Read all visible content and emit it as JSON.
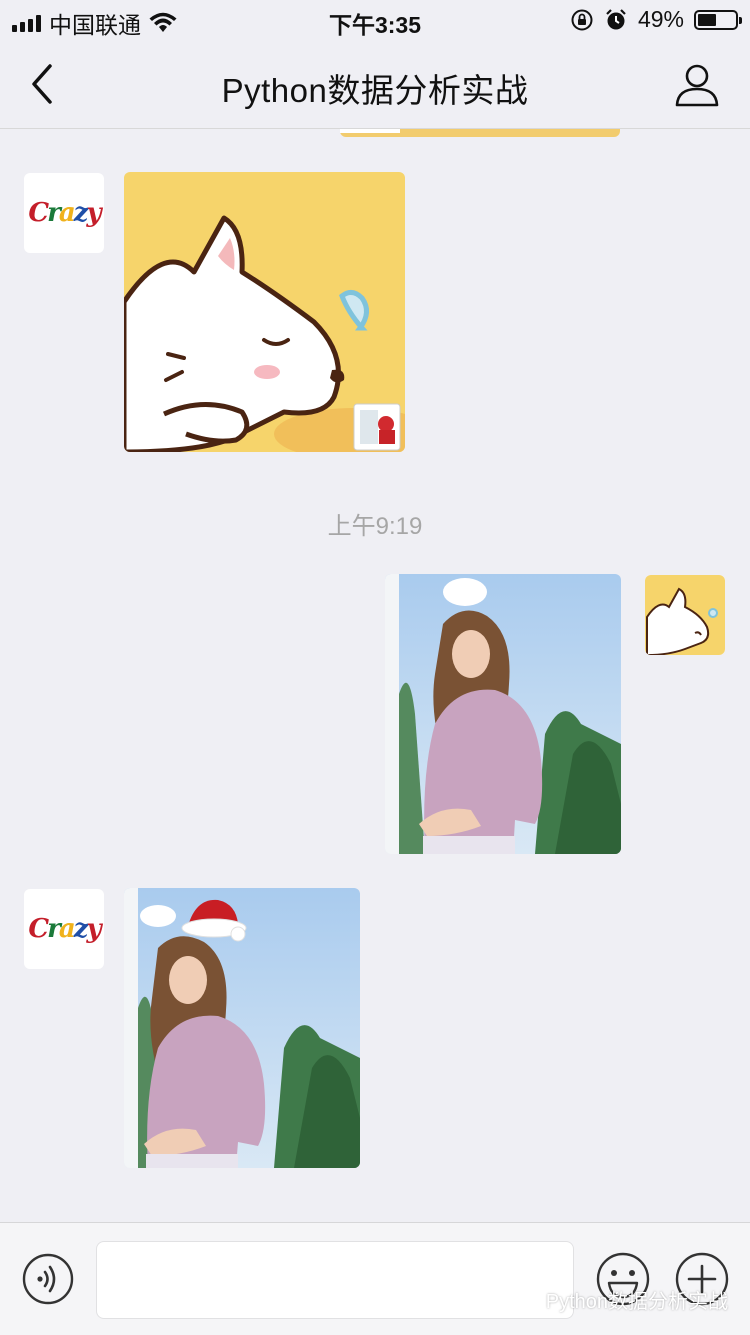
{
  "status_bar": {
    "carrier": "中国联通",
    "time": "下午3:35",
    "battery_percent": "49%",
    "battery_level": 0.49,
    "icons": [
      "signal-icon",
      "wifi-icon",
      "orientation-lock-icon",
      "alarm-icon",
      "battery-icon"
    ]
  },
  "nav": {
    "title": "Python数据分析实战",
    "back_icon": "chevron-left-icon",
    "profile_icon": "person-icon"
  },
  "chat": {
    "time_separator": "上午9:19",
    "messages": [
      {
        "direction": "incoming",
        "sender": "crazy-avatar",
        "type": "image",
        "content": "sticker-white-dog"
      },
      {
        "direction": "outgoing",
        "sender": "self-avatar-dog",
        "type": "image",
        "content": "photo-woman-outdoors"
      },
      {
        "direction": "incoming",
        "sender": "crazy-avatar",
        "type": "image",
        "content": "photo-woman-with-santa-hat"
      }
    ]
  },
  "input_bar": {
    "text_value": "",
    "icons": [
      "voice-icon",
      "emoji-icon",
      "plus-icon"
    ]
  },
  "watermark": {
    "text": "Python数据分析实战"
  },
  "colors": {
    "background": "#efeff4",
    "sticker_yellow": "#f6d46b",
    "timestamp_gray": "#a6a6a6"
  }
}
